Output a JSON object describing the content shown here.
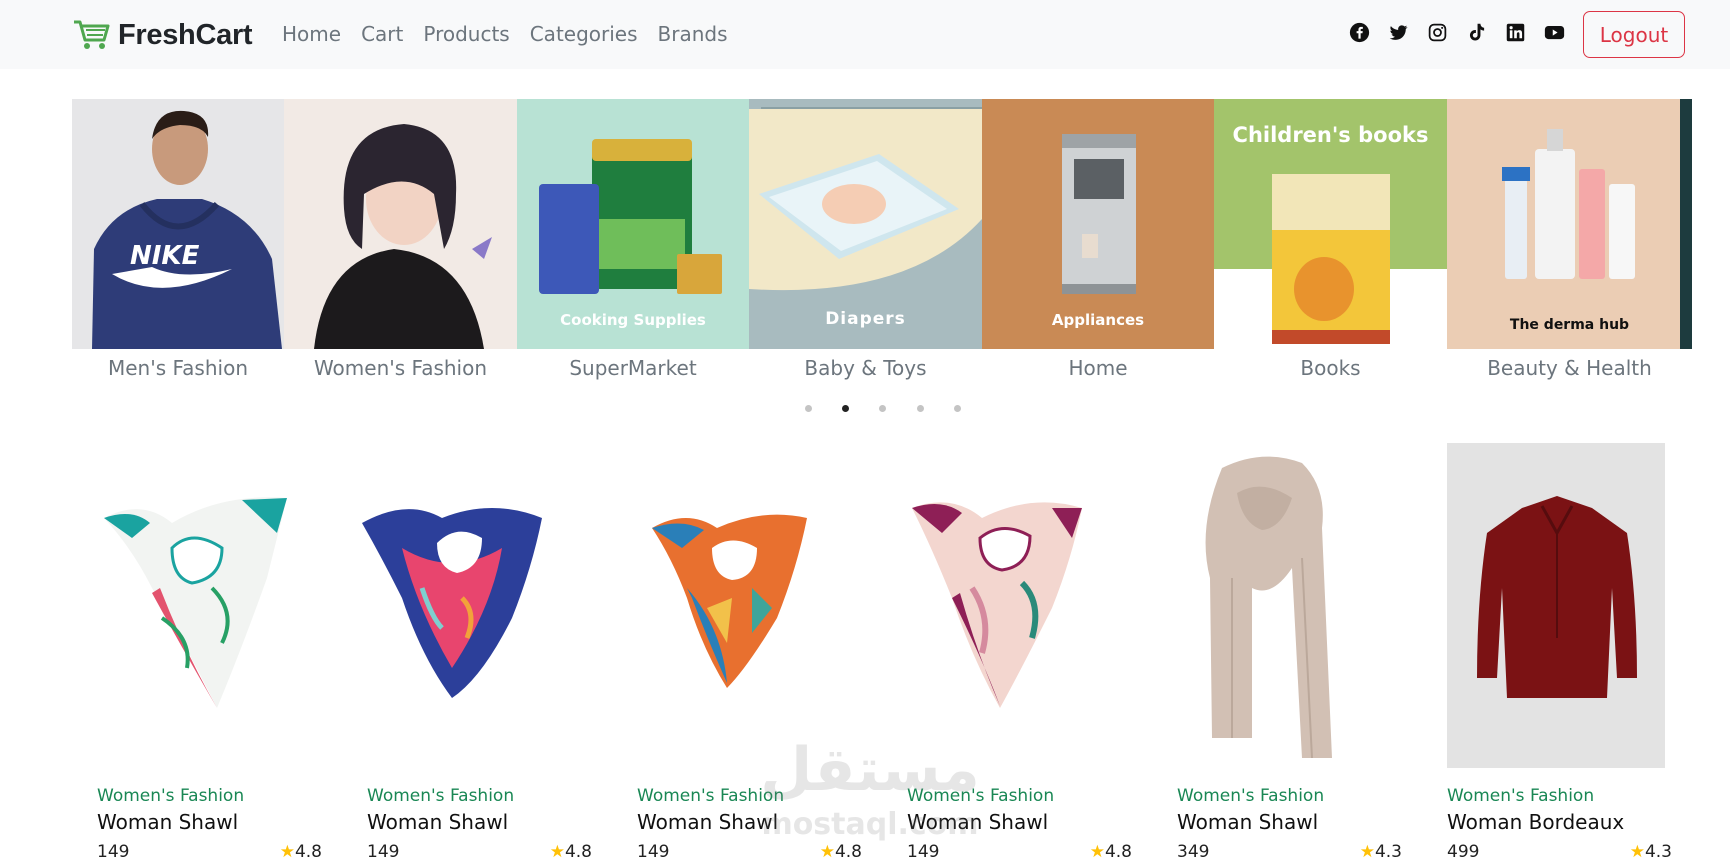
{
  "navbar": {
    "brand": "FreshCart",
    "links": [
      "Home",
      "Cart",
      "Products",
      "Categories",
      "Brands"
    ],
    "social_icons": [
      "facebook-icon",
      "twitter-icon",
      "instagram-icon",
      "tiktok-icon",
      "linkedin-icon",
      "youtube-icon"
    ],
    "logout_label": "Logout"
  },
  "slider": {
    "categories": [
      {
        "name": "Men's Fashion",
        "image_text": ""
      },
      {
        "name": "Women's Fashion",
        "image_text": ""
      },
      {
        "name": "SuperMarket",
        "image_text": "Cooking Supplies"
      },
      {
        "name": "Baby & Toys",
        "image_text": "Diapers"
      },
      {
        "name": "Home",
        "image_text": "Appliances"
      },
      {
        "name": "Books",
        "image_text": "Children's books"
      },
      {
        "name": "Beauty & Health",
        "image_text": "The derma hub"
      }
    ],
    "dots": 5,
    "active_dot": 2
  },
  "products": [
    {
      "category": "Women's Fashion",
      "title": "Woman Shawl",
      "price": "149",
      "rating": "4.8"
    },
    {
      "category": "Women's Fashion",
      "title": "Woman Shawl",
      "price": "149",
      "rating": "4.8"
    },
    {
      "category": "Women's Fashion",
      "title": "Woman Shawl",
      "price": "149",
      "rating": "4.8"
    },
    {
      "category": "Women's Fashion",
      "title": "Woman Shawl",
      "price": "149",
      "rating": "4.8"
    },
    {
      "category": "Women's Fashion",
      "title": "Woman Shawl",
      "price": "349",
      "rating": "4.3"
    },
    {
      "category": "Women's Fashion",
      "title": "Woman Bordeaux",
      "price": "499",
      "rating": "4.3"
    }
  ],
  "watermark": {
    "arabic": "مستقل",
    "latin": "mostaql.com"
  },
  "colors": {
    "brand_green": "#4fa74f",
    "category_green": "#198754",
    "logout_red": "#dc3545",
    "star": "#ffc107"
  }
}
